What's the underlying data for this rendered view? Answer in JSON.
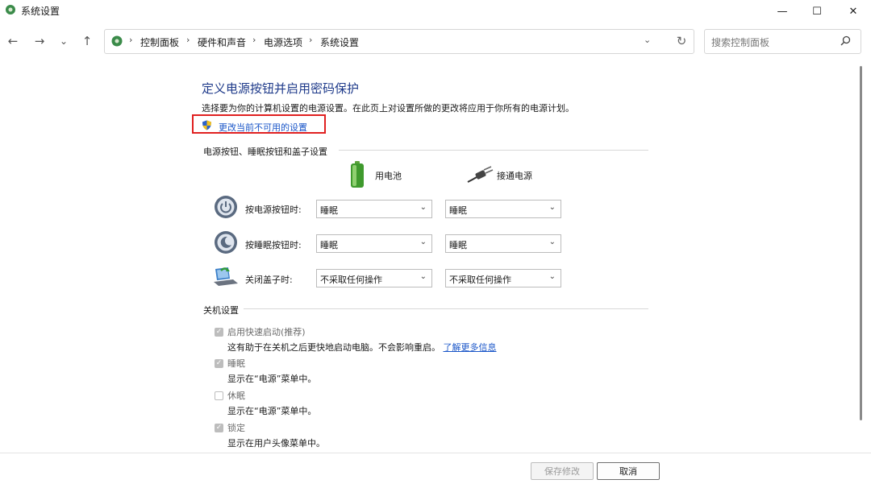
{
  "window": {
    "title": "系统设置",
    "minimize": "—",
    "maximize": "☐",
    "close": "✕"
  },
  "nav": {
    "back": "←",
    "forward": "→",
    "recent": "⌄",
    "up": "↑",
    "breadcrumbs": [
      "控制面板",
      "硬件和声音",
      "电源选项",
      "系统设置"
    ],
    "separator": "›",
    "dropdown": "⌄",
    "refresh": "↻",
    "search_placeholder": "搜索控制面板"
  },
  "content": {
    "title": "定义电源按钮并启用密码保护",
    "description": "选择要为你的计算机设置的电源设置。在此页上对设置所做的更改将应用于你所有的电源计划。",
    "change_link": "更改当前不可用的设置",
    "section_buttons": "电源按钮、睡眠按钮和盖子设置",
    "col_battery": "用电池",
    "col_plugged": "接通电源",
    "rows": [
      {
        "label": "按电源按钮时:",
        "battery": "睡眠",
        "plugged": "睡眠"
      },
      {
        "label": "按睡眠按钮时:",
        "battery": "睡眠",
        "plugged": "睡眠"
      },
      {
        "label": "关闭盖子时:",
        "battery": "不采取任何操作",
        "plugged": "不采取任何操作"
      }
    ],
    "section_shutdown": "关机设置",
    "options": [
      {
        "label": "启用快速启动(推荐)",
        "checked": true,
        "desc": "这有助于在关机之后更快地启动电脑。不会影响重启。",
        "link": "了解更多信息"
      },
      {
        "label": "睡眠",
        "checked": true,
        "desc": "显示在“电源”菜单中。"
      },
      {
        "label": "休眠",
        "checked": false,
        "desc": "显示在“电源”菜单中。"
      },
      {
        "label": "锁定",
        "checked": true,
        "desc": "显示在用户头像菜单中。"
      }
    ]
  },
  "footer": {
    "save": "保存修改",
    "cancel": "取消"
  },
  "colors": {
    "accent_link": "#1a56c8",
    "title_blue": "#1e3a8a",
    "highlight_red": "#e02020"
  }
}
